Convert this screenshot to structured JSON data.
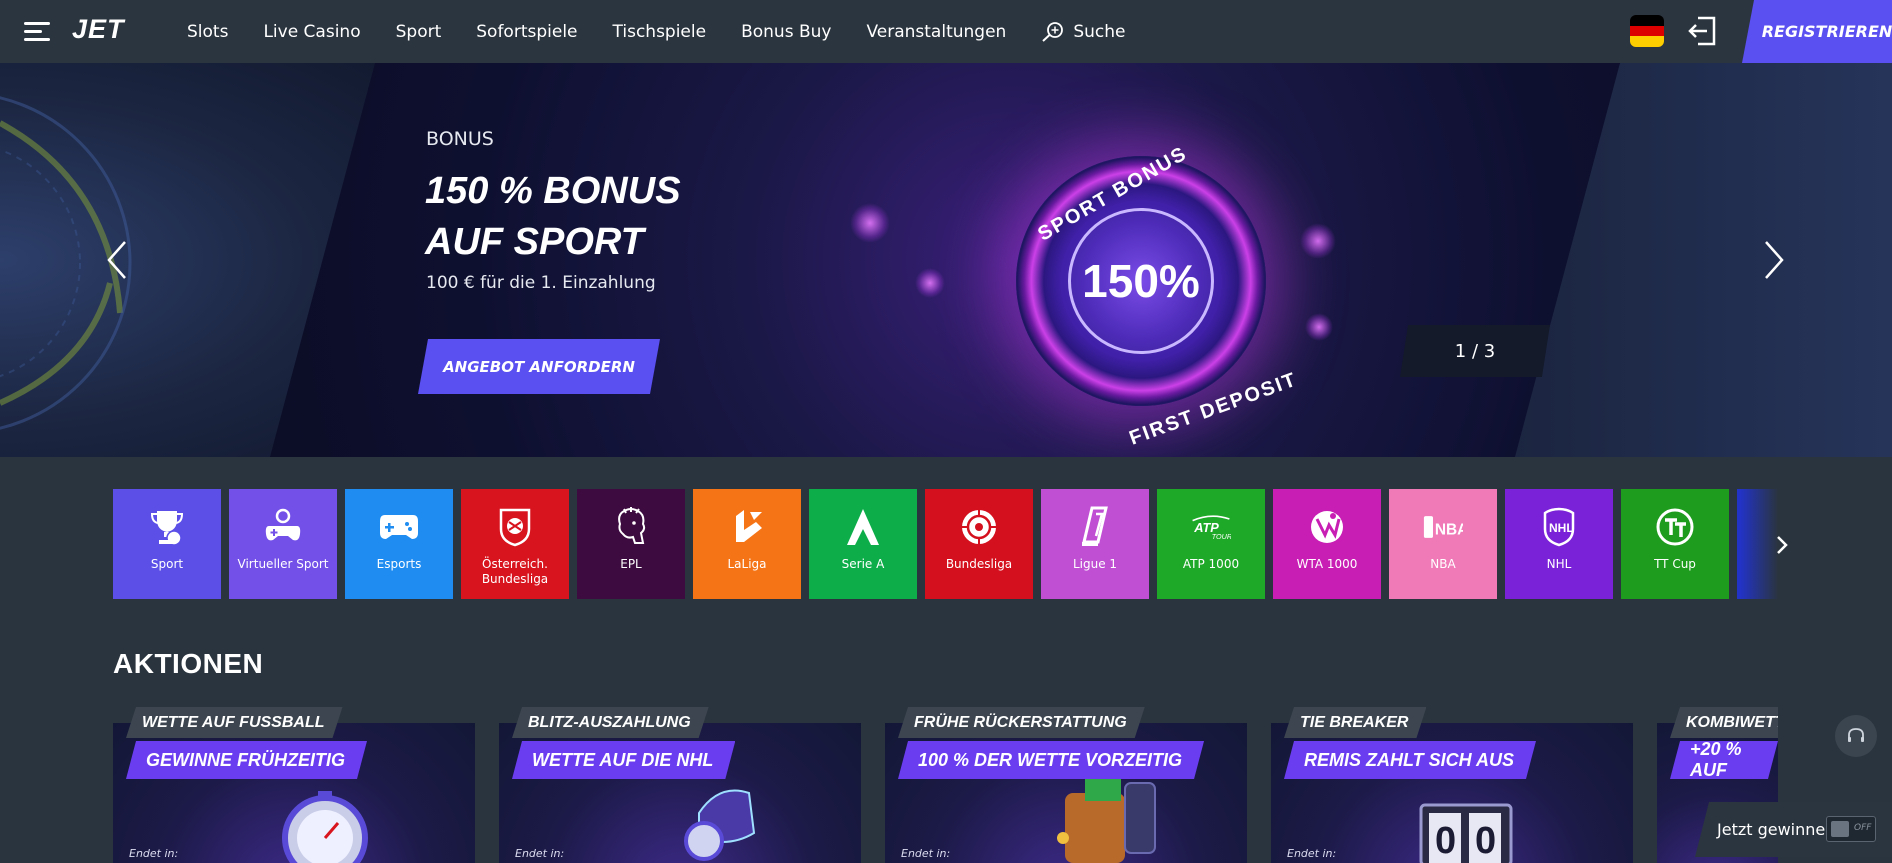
{
  "header": {
    "logo": "JET",
    "nav": [
      "Slots",
      "Live Casino",
      "Sport",
      "Sofortspiele",
      "Tischspiele",
      "Bonus Buy",
      "Veranstaltungen"
    ],
    "search_label": "Suche",
    "register_label": "REGISTRIEREN"
  },
  "hero": {
    "tag": "BONUS",
    "title_line1": "150 % BONUS",
    "title_line2": "AUF SPORT",
    "subtitle": "100 € für die 1. Einzahlung",
    "cta": "ANGEBOT ANFORDERN",
    "badge_value": "150%",
    "badge_top": "SPORT BONUS",
    "badge_bottom": "FIRST DEPOSIT",
    "counter": "1 / 3"
  },
  "categories": [
    {
      "label": "Sport",
      "color": "#5b4fe8",
      "icon": "trophy-icon"
    },
    {
      "label": "Virtueller Sport",
      "color": "#7350e8",
      "icon": "gamepad-icon"
    },
    {
      "label": "Esports",
      "color": "#1e8cf0",
      "icon": "controller-icon"
    },
    {
      "label": "Österreich. Bundesliga",
      "color": "#d8141e",
      "icon": "austria-bundesliga-icon"
    },
    {
      "label": "EPL",
      "color": "#3d0b3f",
      "icon": "lion-icon"
    },
    {
      "label": "LaLiga",
      "color": "#f57416",
      "icon": "laliga-icon"
    },
    {
      "label": "Serie A",
      "color": "#0dae4a",
      "icon": "serie-a-icon"
    },
    {
      "label": "Bundesliga",
      "color": "#d4101e",
      "icon": "ball-icon"
    },
    {
      "label": "Ligue 1",
      "color": "#c14fd4",
      "icon": "ligue1-icon"
    },
    {
      "label": "ATP 1000",
      "color": "#1fa928",
      "icon": "atp-icon"
    },
    {
      "label": "WTA 1000",
      "color": "#c81eb4",
      "icon": "wta-icon"
    },
    {
      "label": "NBA",
      "color": "#f07ab8",
      "icon": "nba-icon"
    },
    {
      "label": "NHL",
      "color": "#7a22d8",
      "icon": "nhl-icon"
    },
    {
      "label": "TT Cup",
      "color": "#1e9c1e",
      "icon": "tt-cup-icon"
    },
    {
      "label": "",
      "color": "#2233c8",
      "icon": "more-icon"
    }
  ],
  "aktionen": {
    "title": "AKTIONEN",
    "promos": [
      {
        "tag": "WETTE AUF FUSSBALL",
        "banner": "GEWINNE FRÜHZEITIG",
        "end": "Endet in:"
      },
      {
        "tag": "BLITZ-AUSZAHLUNG",
        "banner": "WETTE AUF DIE NHL",
        "end": "Endet in:"
      },
      {
        "tag": "FRÜHE RÜCKERSTATTUNG",
        "banner": "100 % DER WETTE VORZEITIG",
        "end": "Endet in:"
      },
      {
        "tag": "TIE BREAKER",
        "banner": "REMIS ZAHLT SICH AUS",
        "end": "Endet in:"
      },
      {
        "tag": "KOMBIWETTE",
        "banner": "+20 % AUF",
        "end": "Endet in:"
      }
    ]
  },
  "jackpot": {
    "label": "Jetzt gewinnen",
    "toggle": "OFF"
  }
}
